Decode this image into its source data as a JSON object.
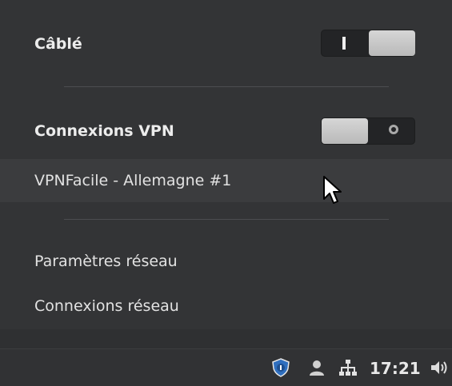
{
  "menu": {
    "wired": {
      "label": "Câblé",
      "enabled": true
    },
    "vpn": {
      "label": "Connexions VPN",
      "enabled": false
    },
    "vpn_items": [
      {
        "label": "VPNFacile - Allemagne #1"
      }
    ],
    "actions": [
      {
        "label": "Paramètres réseau"
      },
      {
        "label": "Connexions réseau"
      }
    ]
  },
  "taskbar": {
    "clock": "17:21",
    "tray_icons": [
      "shield-icon",
      "user-icon",
      "network-icon",
      "volume-icon"
    ]
  },
  "colors": {
    "menu_bg": "#333436",
    "highlight": "#3b3c3e",
    "text": "#e6e6e6"
  }
}
